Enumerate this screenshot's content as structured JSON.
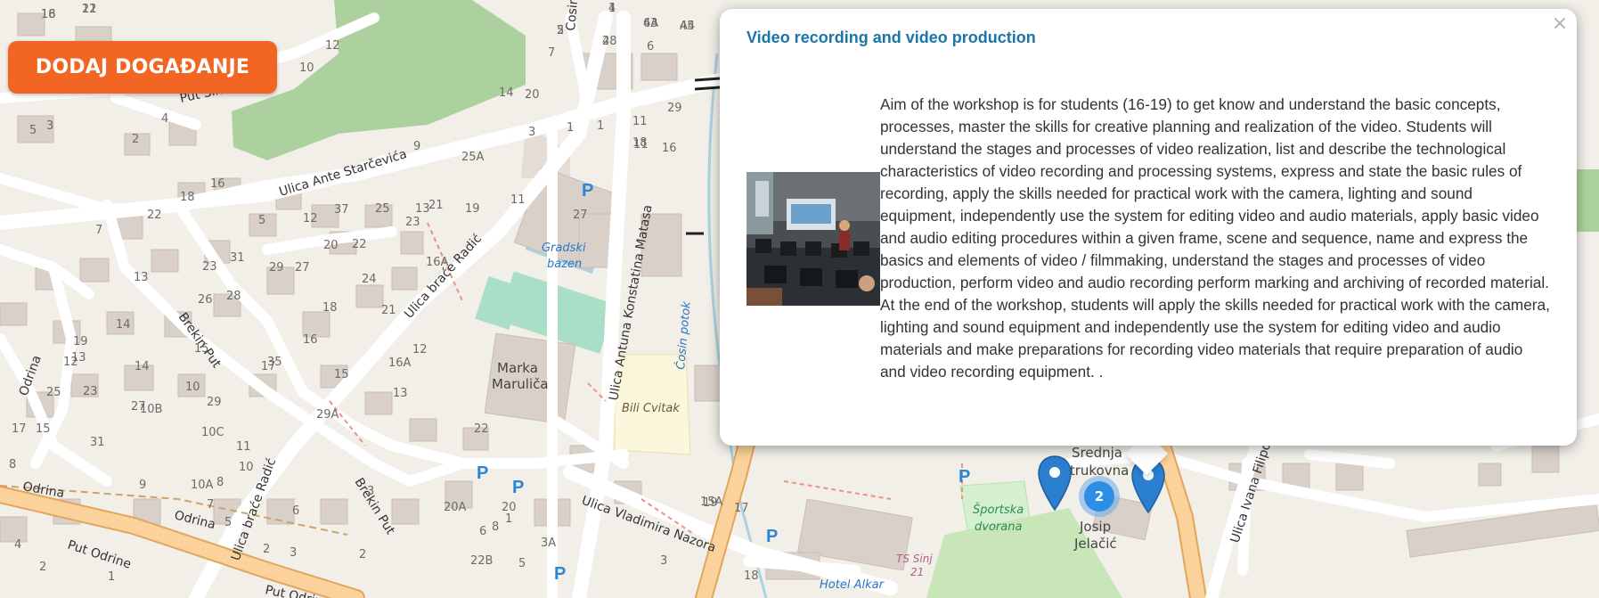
{
  "map": {
    "labels": {
      "streets": [
        "Put Šimaca",
        "Ulica Ante Starčevića",
        "Ulica braće Radić",
        "Brekin Put",
        "Odrina",
        "Put Odrine",
        "Ulica Antuna Konstatina Matasa",
        "Ulica Vladimira Nazora",
        "Ulica Ivana Filipo",
        "Ćosin potok",
        "Cosin"
      ],
      "places": [
        "Marka Marulića",
        "Srednja strukovna",
        "Josip Jelačić",
        "Hotel Alkar",
        "TS Sinj 21"
      ],
      "pois": [
        "Gradski bazen",
        "Bili Cvitak",
        "Športska dvorana"
      ],
      "parking": "P",
      "house_numbers": [
        "18",
        "21",
        "4",
        "6A",
        "A4",
        "5",
        "2",
        "6",
        "12",
        "10",
        "5",
        "3",
        "4",
        "2",
        "7",
        "1",
        "11",
        "14",
        "20",
        "29",
        "3",
        "1",
        "11",
        "18",
        "16",
        "18",
        "16",
        "22",
        "25A",
        "13",
        "9",
        "11",
        "27",
        "7",
        "5",
        "12",
        "37",
        "25",
        "23",
        "21",
        "19",
        "13",
        "23",
        "31",
        "29",
        "27",
        "20",
        "22",
        "24",
        "26",
        "28",
        "16A",
        "18",
        "14",
        "15",
        "35",
        "21",
        "16",
        "19",
        "12",
        "17",
        "15",
        "12",
        "13",
        "14",
        "16A",
        "25",
        "23",
        "10",
        "29",
        "27",
        "17",
        "15",
        "10B",
        "10C",
        "31",
        "13",
        "29A",
        "11",
        "10",
        "8",
        "9",
        "10A",
        "8",
        "7",
        "5",
        "6",
        "3",
        "22",
        "20A",
        "20",
        "22B",
        "3A",
        "8",
        "6",
        "4",
        "2",
        "1",
        "2",
        "3",
        "2",
        "1",
        "5",
        "3",
        "19",
        "17",
        "15A",
        "18",
        "16",
        "12",
        "1",
        "43",
        "45",
        "2",
        "48"
      ]
    },
    "cluster_count": "2"
  },
  "toolbar": {
    "add_event_label": "DODAJ DOGAĐANJE"
  },
  "popup": {
    "title": "Video recording and video production",
    "close_label": "×",
    "description": "Aim of the workshop is for students (16-19) to get know and understand the basic concepts, processes, master the skills for creative planning and realization of the video. Students will understand the stages and processes of video realization, list and describe the technological characteristics of video recording and processing systems, express and state the basic rules of recording, apply the skills needed for practical work with the camera, lighting and sound equipment, independently use the system for editing video and audio materials, apply basic video and audio editing procedures within a given frame, scene and sequence, name and express the basics and elements of video / filmmaking, understand the stages and processes of video production, perform video and audio recording perform marking and archiving of recorded material. At the end of the workshop, students will apply the skills needed for practical work with the camera, lighting and sound equipment and independently use the system for editing video and audio materials and make preparations for recording video materials that require preparation of audio and video recording equipment. ."
  },
  "colors": {
    "button": "#f26522",
    "title": "#1a75a8",
    "marker": "#2a7fd0",
    "road_major": "#f7c97e",
    "park": "#aedba2"
  }
}
